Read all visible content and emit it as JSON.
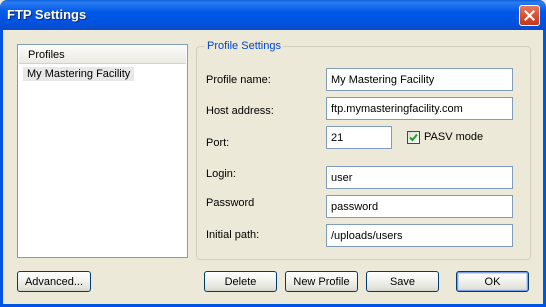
{
  "window": {
    "title": "FTP Settings"
  },
  "profiles": {
    "header": "Profiles",
    "items": [
      "My Mastering Facility"
    ]
  },
  "settings": {
    "group_label": "Profile Settings",
    "profile_name": {
      "label": "Profile name:",
      "value": "My Mastering Facility"
    },
    "host_address": {
      "label": "Host address:",
      "value": "ftp.mymasteringfacility.com"
    },
    "port": {
      "label": "Port:",
      "value": "21"
    },
    "pasv_mode": {
      "label": "PASV mode",
      "checked": true
    },
    "login": {
      "label": "Login:",
      "value": "user"
    },
    "password": {
      "label": "Password",
      "value": "password"
    },
    "initial_path": {
      "label": "Initial path:",
      "value": "/uploads/users"
    }
  },
  "buttons": {
    "advanced": "Advanced...",
    "delete": "Delete",
    "new_profile": "New Profile",
    "save": "Save",
    "ok": "OK"
  },
  "colors": {
    "titlebar": "#0054e3",
    "close": "#d9482a",
    "group_label": "#0046d5",
    "window_bg": "#ece9d8"
  }
}
